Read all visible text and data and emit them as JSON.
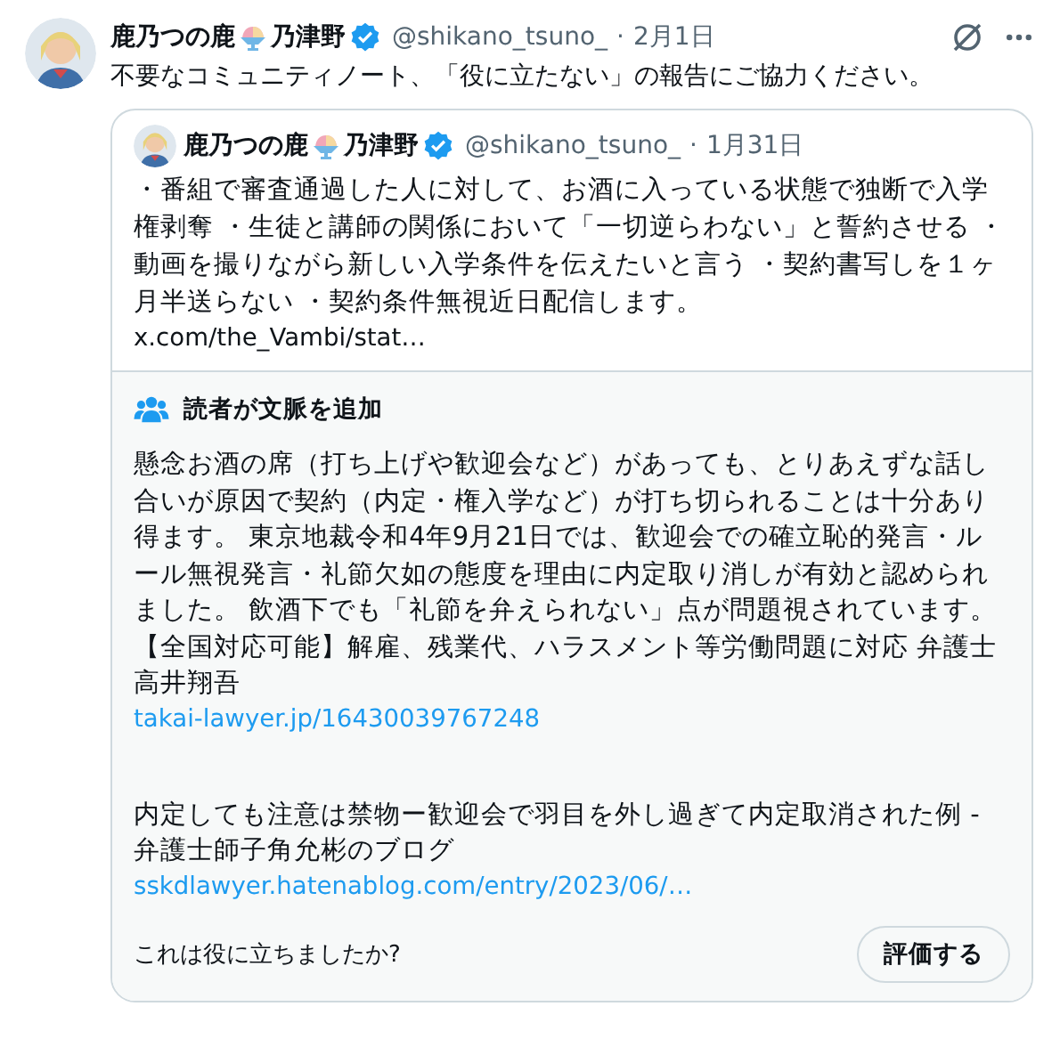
{
  "post": {
    "author": {
      "name_before": "鹿乃つの鹿",
      "name_after": "乃津野",
      "verified": true,
      "handle": "@shikano_tsuno_",
      "separator": "·",
      "date": "2月1日"
    },
    "text": "不要なコミュニティノート、「役に立たない」の報告にご協力ください。",
    "quoted_post": {
      "author": {
        "name_before": "鹿乃つの鹿",
        "name_after": "乃津野",
        "verified": true,
        "handle": "@shikano_tsuno_",
        "separator": "·",
        "date": "1月31日"
      },
      "text": "・番組で審査通過した人に対して、お酒に入っている状態で独断で入学権剥奪 ・生徒と講師の関係において「一切逆らわない」と誓約させる ・動画を撮りながら新しい入学条件を伝えたいと言う ・契約書写しを１ヶ月半送らない ・契約条件無視近日配信します。",
      "link": "x.com/the_Vambi/stat…"
    },
    "note": {
      "heading": "読者が文脈を追加",
      "paragraphs": [
        {
          "text": "懸念お酒の席（打ち上げや歓迎会など）があっても、とりあえずな話し合いが原因で契約（内定・権入学など）が打ち切られることは十分あり得ます。 東京地裁令和4年9月21日では、歓迎会での確立恥的発言・ルール無視発言・礼節欠如の態度を理由に内定取り消しが有効と認められました。 飲酒下でも「礼節を弁えられない」点が問題視されています。"
        },
        {
          "text": "【全国対応可能】解雇、残業代、ハラスメント等労働問題に対応 弁護士高井翔吾",
          "link": "takai-lawyer.jp/16430039767248"
        },
        {
          "text": "内定しても注意は禁物ー歓迎会で羽目を外し過ぎて内定取消された例 - 弁護士師子角允彬のブログ",
          "link": "sskdlawyer.hatenablog.com/entry/2023/06/…"
        }
      ],
      "question": "これは役に立ちましたか?",
      "rate_button": "評価する"
    }
  }
}
